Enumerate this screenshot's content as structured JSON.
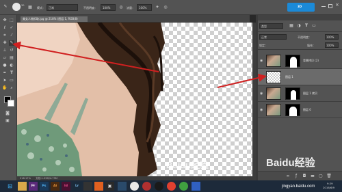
{
  "options_bar": {
    "mode_label": "模式：",
    "mode_value": "正常",
    "opacity_label": "不透明度：",
    "opacity_value": "100%",
    "flow_label": "流量：",
    "flow_value": "100%",
    "brush_size": "30"
  },
  "top_badge": "3D",
  "document": {
    "tab_title": "美女人物扣取.jpg @ 218% (图层 1, RGB/8)",
    "status_zoom": "218.17%",
    "status_doc": "文档:1.59M/4.79M"
  },
  "layers_panel": {
    "kind_label": "类型",
    "blend_mode": "正常",
    "opacity_label": "不透明度：",
    "opacity_value": "100%",
    "fill_label": "填充：",
    "fill_value": "100%",
    "lock_label": "锁定：",
    "layers": [
      {
        "name": "背景拷贝 (2)",
        "selected": false
      },
      {
        "name": "图层 1",
        "selected": true
      },
      {
        "name": "图层 1 拷贝",
        "selected": false
      },
      {
        "name": "图层 0",
        "selected": false
      }
    ]
  },
  "watermark": {
    "text": "Baidu经验",
    "url": "jingyan.baidu.com"
  },
  "clock": {
    "time": "9:29",
    "date": "2016/6/9"
  },
  "icons": [
    "move-icon",
    "marquee-icon",
    "lasso-icon",
    "quick-select-icon",
    "crop-icon",
    "eyedropper-icon",
    "healing-icon",
    "brush-icon",
    "stamp-icon",
    "history-brush-icon",
    "eraser-icon",
    "gradient-icon",
    "blur-icon",
    "dodge-icon",
    "pen-icon",
    "type-icon",
    "path-select-icon",
    "shape-icon",
    "hand-icon",
    "zoom-icon",
    "eye-icon"
  ],
  "taskbar_apps": [
    "Pr",
    "Ps",
    "Ai",
    "Id",
    "Lr"
  ],
  "colors": {
    "arrow": "#d02020",
    "ui_gray": "#535353",
    "selected_layer": "#6b6b6b"
  }
}
